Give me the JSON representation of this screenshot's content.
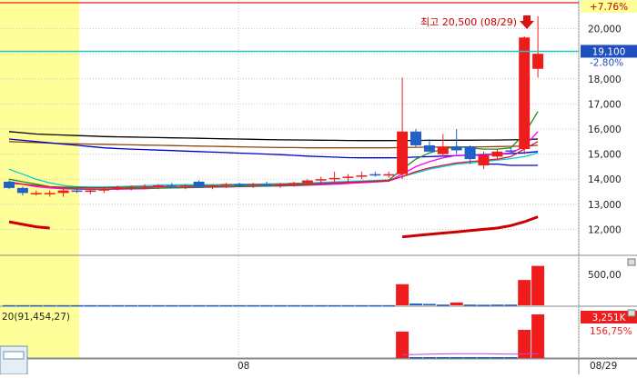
{
  "chart_data": [
    {
      "type": "candlestick",
      "panel": "price",
      "ylim": [
        11000,
        21000
      ],
      "y_ticks": [
        12000,
        13000,
        14000,
        15000,
        16000,
        17000,
        18000,
        19000,
        20000
      ],
      "y_tick_labels": [
        "12,000",
        "13,000",
        "14,000",
        "15,000",
        "16,000",
        "17,000",
        "18,000",
        "19,000",
        "20,000"
      ],
      "x_tick_labels": [
        "08",
        "08/29"
      ],
      "annotation": "최고 20,500 (08/29)",
      "top_badge": "+7.76%",
      "current_price": 19100,
      "current_price_label": "19,100",
      "change_label": "-2.80%",
      "grid": true,
      "candles": [
        {
          "o": 13900,
          "h": 13950,
          "l": 13600,
          "c": 13650
        },
        {
          "o": 13650,
          "h": 13700,
          "l": 13350,
          "c": 13450
        },
        {
          "o": 13450,
          "h": 13550,
          "l": 13350,
          "c": 13450
        },
        {
          "o": 13450,
          "h": 13550,
          "l": 13300,
          "c": 13450
        },
        {
          "o": 13450,
          "h": 13700,
          "l": 13300,
          "c": 13550
        },
        {
          "o": 13550,
          "h": 13700,
          "l": 13450,
          "c": 13500
        },
        {
          "o": 13500,
          "h": 13650,
          "l": 13400,
          "c": 13550
        },
        {
          "o": 13550,
          "h": 13700,
          "l": 13450,
          "c": 13600
        },
        {
          "o": 13600,
          "h": 13750,
          "l": 13550,
          "c": 13650
        },
        {
          "o": 13650,
          "h": 13750,
          "l": 13550,
          "c": 13700
        },
        {
          "o": 13700,
          "h": 13800,
          "l": 13600,
          "c": 13700
        },
        {
          "o": 13700,
          "h": 13800,
          "l": 13600,
          "c": 13750
        },
        {
          "o": 13750,
          "h": 13850,
          "l": 13650,
          "c": 13700
        },
        {
          "o": 13700,
          "h": 13800,
          "l": 13600,
          "c": 13750
        },
        {
          "o": 13900,
          "h": 13950,
          "l": 13650,
          "c": 13700
        },
        {
          "o": 13700,
          "h": 13800,
          "l": 13600,
          "c": 13750
        },
        {
          "o": 13750,
          "h": 13850,
          "l": 13650,
          "c": 13800
        },
        {
          "o": 13800,
          "h": 13850,
          "l": 13700,
          "c": 13750
        },
        {
          "o": 13750,
          "h": 13850,
          "l": 13650,
          "c": 13800
        },
        {
          "o": 13800,
          "h": 13900,
          "l": 13700,
          "c": 13750
        },
        {
          "o": 13750,
          "h": 13850,
          "l": 13650,
          "c": 13800
        },
        {
          "o": 13800,
          "h": 13900,
          "l": 13700,
          "c": 13850
        },
        {
          "o": 13850,
          "h": 14000,
          "l": 13750,
          "c": 13950
        },
        {
          "o": 13950,
          "h": 14100,
          "l": 13800,
          "c": 14000
        },
        {
          "o": 14000,
          "h": 14300,
          "l": 13850,
          "c": 14050
        },
        {
          "o": 14050,
          "h": 14200,
          "l": 13900,
          "c": 14100
        },
        {
          "o": 14100,
          "h": 14300,
          "l": 14000,
          "c": 14150
        },
        {
          "o": 14200,
          "h": 14300,
          "l": 14100,
          "c": 14150
        },
        {
          "o": 14150,
          "h": 14300,
          "l": 14050,
          "c": 14200
        },
        {
          "o": 14200,
          "h": 18050,
          "l": 14000,
          "c": 15900
        },
        {
          "o": 15900,
          "h": 16000,
          "l": 15300,
          "c": 15350
        },
        {
          "o": 15350,
          "h": 15600,
          "l": 15100,
          "c": 15100
        },
        {
          "o": 15000,
          "h": 15800,
          "l": 14900,
          "c": 15300
        },
        {
          "o": 15300,
          "h": 16000,
          "l": 15000,
          "c": 15150
        },
        {
          "o": 15300,
          "h": 15350,
          "l": 14600,
          "c": 14800
        },
        {
          "o": 14550,
          "h": 15100,
          "l": 14400,
          "c": 14950
        },
        {
          "o": 14900,
          "h": 15200,
          "l": 14800,
          "c": 15100
        },
        {
          "o": 15150,
          "h": 15250,
          "l": 15000,
          "c": 15100
        },
        {
          "o": 15200,
          "h": 19700,
          "l": 15000,
          "c": 19650
        },
        {
          "o": 18400,
          "h": 20500,
          "l": 18050,
          "c": 19000
        }
      ],
      "overlay_series": [
        {
          "color": "#000000",
          "values": [
            15900,
            15850,
            15800,
            15780,
            15760,
            15740,
            15720,
            15700,
            15690,
            15680,
            15670,
            15660,
            15650,
            15640,
            15630,
            15620,
            15610,
            15600,
            15590,
            15580,
            15570,
            15565,
            15560,
            15555,
            15550,
            15545,
            15540,
            15540,
            15540,
            15545,
            15545,
            15550,
            15550,
            15555,
            15555,
            15560,
            15560,
            15570,
            15580,
            15600
          ]
        },
        {
          "color": "#8b4513",
          "values": [
            15500,
            15480,
            15460,
            15440,
            15420,
            15410,
            15400,
            15390,
            15380,
            15370,
            15360,
            15350,
            15340,
            15330,
            15320,
            15310,
            15300,
            15290,
            15280,
            15270,
            15260,
            15260,
            15250,
            15250,
            15250,
            15250,
            15250,
            15250,
            15250,
            15260,
            15270,
            15280,
            15280,
            15290,
            15290,
            15290,
            15300,
            15310,
            15320,
            15350
          ]
        },
        {
          "color": "#0000cd",
          "values": [
            15600,
            15550,
            15500,
            15450,
            15400,
            15350,
            15300,
            15250,
            15220,
            15200,
            15180,
            15160,
            15140,
            15120,
            15100,
            15080,
            15060,
            15040,
            15020,
            15000,
            14980,
            14950,
            14920,
            14900,
            14880,
            14860,
            14850,
            14850,
            14850,
            14860,
            14880,
            14900,
            14920,
            14940,
            14960,
            14980,
            15000,
            15020,
            15050,
            15100
          ]
        },
        {
          "color": "#00ced1",
          "values": [
            14400,
            14200,
            14000,
            13850,
            13750,
            13700,
            13690,
            13690,
            13700,
            13720,
            13740,
            13760,
            13770,
            13780,
            13780,
            13780,
            13790,
            13800,
            13800,
            13810,
            13820,
            13830,
            13850,
            13870,
            13890,
            13910,
            13930,
            13950,
            13970,
            14100,
            14250,
            14400,
            14500,
            14600,
            14650,
            14700,
            14760,
            14820,
            14900,
            15050
          ]
        },
        {
          "color": "#ff00ff",
          "values": [
            13900,
            13800,
            13700,
            13650,
            13620,
            13600,
            13590,
            13590,
            13600,
            13610,
            13620,
            13640,
            13650,
            13660,
            13670,
            13680,
            13690,
            13700,
            13710,
            13720,
            13730,
            13740,
            13760,
            13780,
            13800,
            13830,
            13860,
            13890,
            13920,
            14200,
            14500,
            14700,
            14850,
            14950,
            14950,
            14950,
            15000,
            15050,
            15300,
            15900
          ]
        },
        {
          "color": "#228b22",
          "values": [
            14000,
            13900,
            13800,
            13700,
            13650,
            13620,
            13610,
            13610,
            13620,
            13630,
            13640,
            13650,
            13660,
            13670,
            13680,
            13690,
            13700,
            13710,
            13720,
            13730,
            13740,
            13760,
            13780,
            13810,
            13840,
            13870,
            13900,
            13930,
            13960,
            14400,
            14800,
            15050,
            15200,
            15300,
            15250,
            15200,
            15200,
            15250,
            15800,
            16700
          ]
        },
        {
          "color": "#dc143c",
          "values": [
            13850,
            13800,
            13750,
            13700,
            13680,
            13670,
            13660,
            13660,
            13670,
            13680,
            13690,
            13700,
            13710,
            13720,
            13730,
            13740,
            13750,
            13760,
            13770,
            13780,
            13790,
            13800,
            13810,
            13830,
            13850,
            13870,
            13890,
            13910,
            13930,
            14100,
            14300,
            14450,
            14550,
            14650,
            14700,
            14750,
            14800,
            14900,
            15200,
            15500
          ]
        }
      ],
      "overlay_extra": {
        "color": "#0000cd",
        "values": [
          14600,
          14600,
          14550,
          14550,
          14550
        ]
      },
      "bottom_curve": {
        "color": "#cc0000",
        "values": [
          12300,
          12200,
          12100,
          12050,
          null,
          null,
          null,
          null,
          null,
          null,
          null,
          null,
          null,
          null,
          null,
          null,
          null,
          null,
          null,
          null,
          null,
          null,
          null,
          null,
          null,
          null,
          null,
          null,
          null,
          11700,
          11750,
          11800,
          11850,
          11900,
          11950,
          12000,
          12050,
          12150,
          12300,
          12500
        ]
      }
    },
    {
      "type": "bar",
      "panel": "volume",
      "y_tick_labels": [
        "500,00"
      ],
      "values": [
        2,
        2,
        2,
        2,
        2,
        2,
        2,
        2,
        2,
        2,
        2,
        2,
        2,
        2,
        2,
        2,
        2,
        2,
        2,
        2,
        2,
        2,
        2,
        2,
        2,
        2,
        2,
        2,
        2,
        300,
        25,
        20,
        10,
        40,
        10,
        8,
        10,
        10,
        360,
        560
      ],
      "ylim": [
        0,
        620
      ]
    },
    {
      "type": "bar",
      "panel": "indicator",
      "legend_label": "20(91,454,27)",
      "badge_value": "3,251K",
      "badge_value2": "156,75%",
      "values": [
        0,
        0,
        0,
        0,
        0,
        0,
        0,
        0,
        0,
        0,
        0,
        0,
        0,
        0,
        0,
        0,
        0,
        0,
        0,
        0,
        0,
        0,
        0,
        0,
        0,
        0,
        0,
        0,
        0,
        290,
        10,
        10,
        10,
        10,
        10,
        10,
        10,
        10,
        310,
        480
      ],
      "line_values": [
        null,
        null,
        null,
        null,
        null,
        null,
        null,
        null,
        null,
        null,
        null,
        null,
        null,
        null,
        null,
        null,
        null,
        null,
        null,
        null,
        null,
        null,
        null,
        null,
        null,
        null,
        null,
        null,
        null,
        60,
        65,
        70,
        75,
        80,
        80,
        80,
        75,
        70,
        75,
        80
      ],
      "ylim": [
        0,
        500
      ]
    }
  ],
  "colors": {
    "up": "#ee1c1c",
    "down": "#1f61c8",
    "highlight": "#ffff99",
    "price_line": "#22c4c4",
    "top_line": "#ee1c1c",
    "badge_up": "#ffff99",
    "badge_current": "#1f4fbf"
  },
  "icons": [
    "down-arrow-icon",
    "collapse-icon",
    "scroll-handle-icon"
  ]
}
